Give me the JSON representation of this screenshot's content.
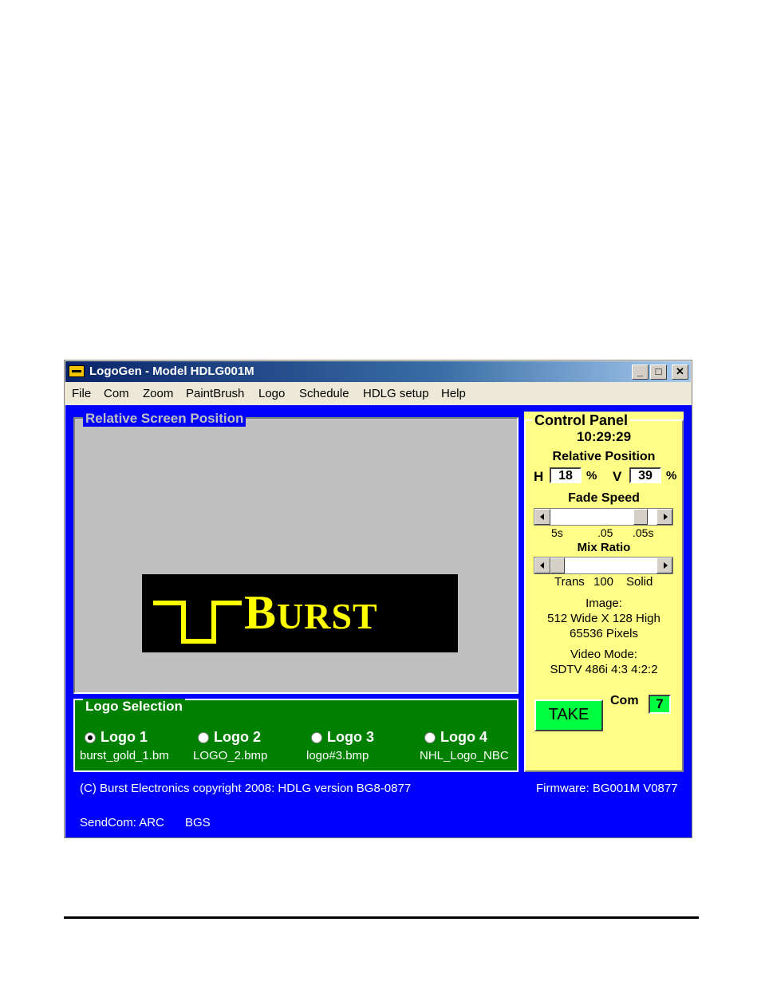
{
  "window": {
    "title": "LogoGen - Model HDLG001M",
    "minimize_label": "_",
    "maximize_label": "□",
    "close_label": "✕"
  },
  "menu": [
    "File",
    "Com",
    "Zoom",
    "PaintBrush",
    "Logo",
    "Schedule",
    "HDLG setup",
    "Help"
  ],
  "preview": {
    "legend": "Relative Screen Position",
    "logo_text_big": "B",
    "logo_text_small": "URST"
  },
  "logo_selection": {
    "legend": "Logo Selection",
    "items": [
      {
        "label": "Logo 1",
        "file": "burst_gold_1.bm",
        "selected": true
      },
      {
        "label": "Logo 2",
        "file": "LOGO_2.bmp",
        "selected": false
      },
      {
        "label": "Logo 3",
        "file": "logo#3.bmp",
        "selected": false
      },
      {
        "label": "Logo 4",
        "file": "NHL_Logo_NBC",
        "selected": false
      }
    ]
  },
  "control_panel": {
    "legend": "Control Panel",
    "time": "10:29:29",
    "relative_position_label": "Relative Position",
    "h_label": "H",
    "h_value": "18",
    "v_label": "V",
    "v_value": "39",
    "percent": "%",
    "fade_speed_label": "Fade Speed",
    "fade_ticks": [
      "5s",
      ".05",
      ".05s"
    ],
    "fade_level": 0.9,
    "mix_ratio_label": "Mix Ratio",
    "mix_ticks": [
      "Trans",
      "100",
      "Solid"
    ],
    "mix_level": 0.0,
    "image_label": "Image:",
    "image_size": "512 Wide X 128 High",
    "image_pixels": "65536 Pixels",
    "video_mode_label": "Video Mode:",
    "video_mode": "SDTV 486i 4:3 4:2:2",
    "take_label": "TAKE",
    "com_label": "Com",
    "com_value": "7"
  },
  "status": {
    "copyright": "(C) Burst Electronics copyright 2008: HDLG version BG8-0877",
    "firmware": "Firmware: BG001M V0877",
    "sendcom": "SendCom: ARC",
    "bgs": "BGS"
  },
  "colors": {
    "client_bg": "#0000ff",
    "logo_yellow": "#ffff00",
    "control_panel_bg": "#ffff88",
    "logo_selection_bg": "#008000",
    "take_button": "#00ff40"
  }
}
